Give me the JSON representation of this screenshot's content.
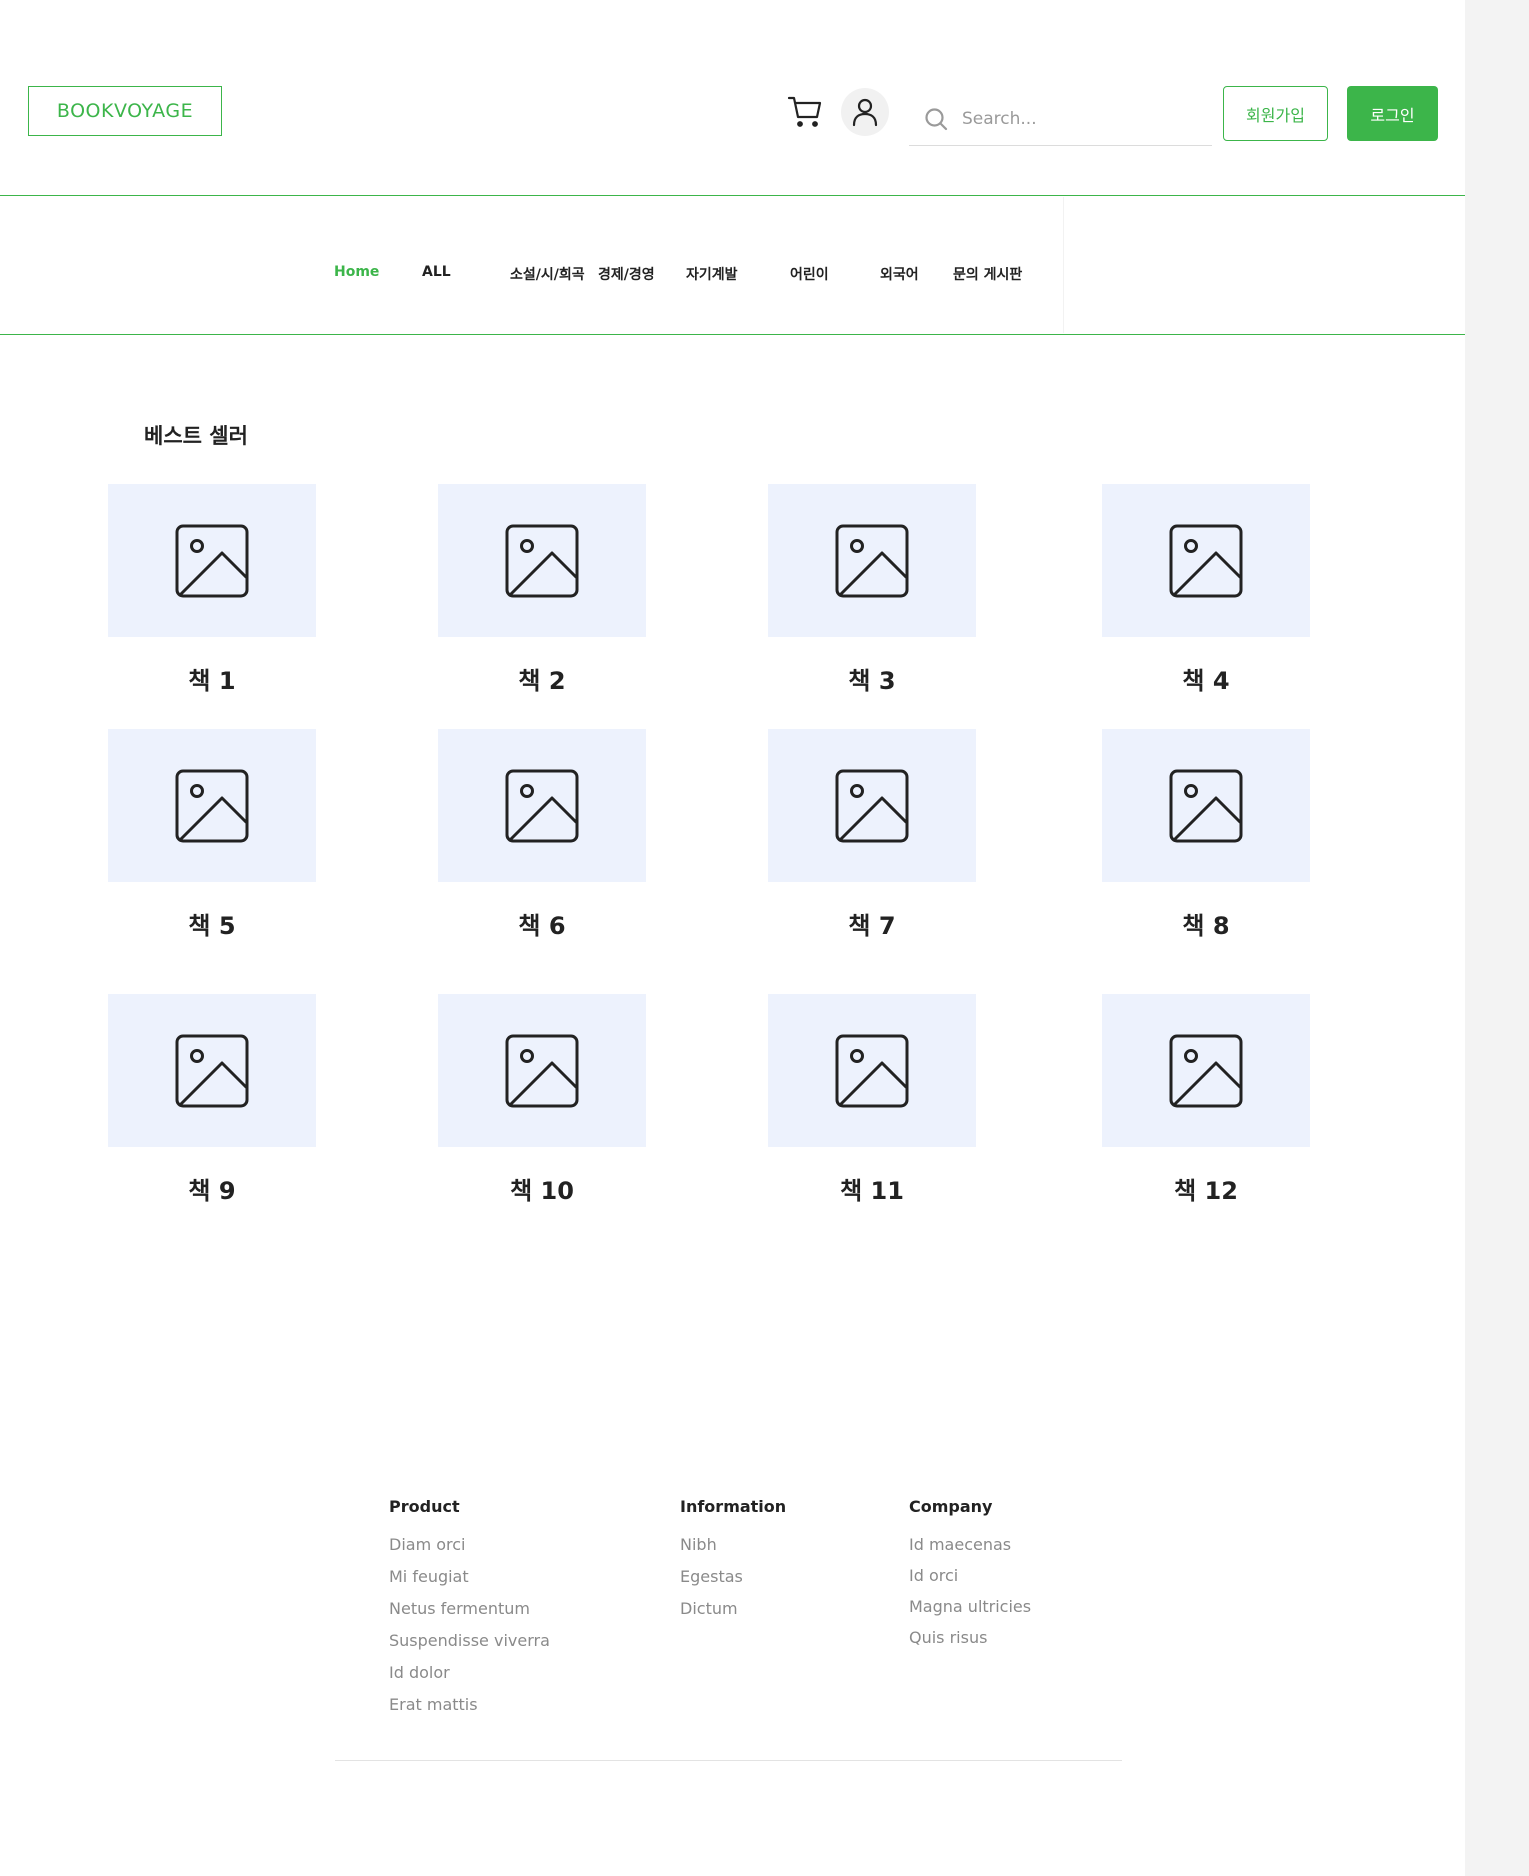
{
  "header": {
    "logo": "BOOKVOYAGE",
    "search_placeholder": "Search...",
    "signup_label": "회원가입",
    "login_label": "로그인",
    "icons": [
      "cart-icon",
      "user-icon",
      "search-icon"
    ]
  },
  "nav": {
    "items": [
      {
        "label": "Home",
        "active": true
      },
      {
        "label": "ALL"
      },
      {
        "label": "소설/시/희곡"
      },
      {
        "label": "경제/경영"
      },
      {
        "label": "자기계발"
      },
      {
        "label": "어린이"
      },
      {
        "label": "외국어"
      },
      {
        "label": "문의 게시판"
      }
    ]
  },
  "bestseller": {
    "title": "베스트 셀러",
    "books": [
      "책 1",
      "책 2",
      "책 3",
      "책 4",
      "책 5",
      "책 6",
      "책 7",
      "책 8",
      "책 9",
      "책 10",
      "책 11",
      "책 12"
    ]
  },
  "footer": {
    "columns": [
      {
        "heading": "Product",
        "links": [
          "Diam orci",
          "Mi feugiat",
          "Netus fermentum",
          "Suspendisse viverra",
          "Id dolor",
          "Erat mattis"
        ]
      },
      {
        "heading": "Information",
        "links": [
          "Nibh",
          "Egestas",
          "Dictum"
        ]
      },
      {
        "heading": "Company",
        "links": [
          "Id maecenas",
          "Id orci",
          "Magna ultricies",
          "Quis risus"
        ]
      }
    ]
  },
  "colors": {
    "accent": "#3cb54a",
    "card_bg": "#edf2fd",
    "muted_text": "#8a8a8a"
  }
}
